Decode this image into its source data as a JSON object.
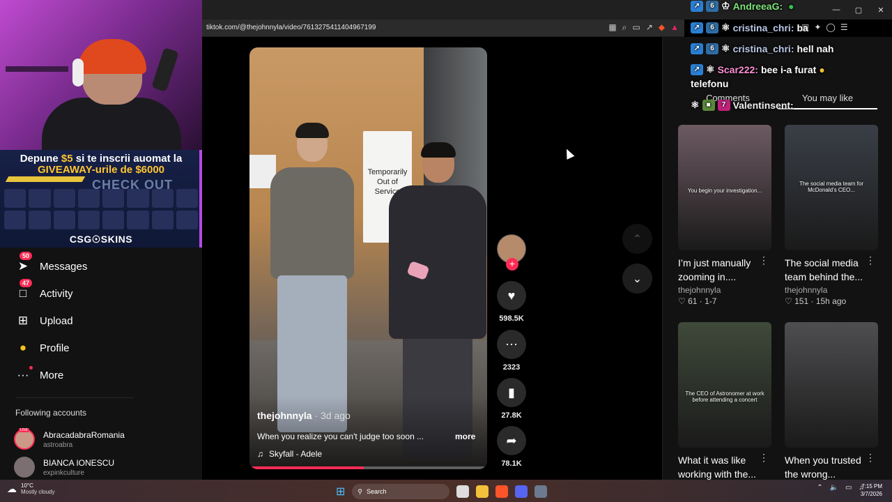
{
  "webcam_overlay": {
    "promo_line1_prefix": "Depune",
    "promo_amount1": "$5",
    "promo_line1_suffix": "si te inscrii auomat la",
    "promo_line2_prefix": "GIVEAWAY-urile de",
    "promo_amount2": "$6000",
    "promo_check": "CHECK OUT",
    "brand": "CSG☉SKINS"
  },
  "browser": {
    "url": "tiktok.com/@thejohnnyla/video/7613275411404967199",
    "window_controls": [
      "—",
      "▢",
      "✕"
    ]
  },
  "sidebar": {
    "items": [
      {
        "label": "Messages",
        "icon": "paper-plane-icon",
        "badge": "50"
      },
      {
        "label": "Activity",
        "icon": "inbox-icon",
        "badge": "47"
      },
      {
        "label": "Upload",
        "icon": "plus-square-icon"
      },
      {
        "label": "Profile",
        "icon": "avatar-emoji-icon"
      },
      {
        "label": "More",
        "icon": "ellipsis-icon"
      }
    ],
    "following_title": "Following accounts",
    "following": [
      {
        "name": "AbracadabraRomania",
        "handle": "astroabra",
        "live": "LIVE"
      },
      {
        "name": "BIANCA IONESCU",
        "handle": "expinkculture"
      }
    ]
  },
  "video": {
    "author": "thejohnnyla",
    "posted": " · 3d ago",
    "caption": "When you realize you can't judge too soon ...",
    "more_label": "more",
    "music": "Skyfall - Adele",
    "sign_text": "Temporarily Out of Service",
    "progress_fraction": 0.48
  },
  "actions": {
    "likes": "598.5K",
    "comments": "2323",
    "saves": "27.8K",
    "shares": "78.1K"
  },
  "chat": [
    {
      "user": "AndreeaG:",
      "message": "",
      "color": "#7ee37a"
    },
    {
      "user": "cristina_chri:",
      "message": "ba",
      "color": "#b9c6e4"
    },
    {
      "user": "cristina_chri:",
      "message": "hell nah",
      "color": "#b9c6e4"
    },
    {
      "user": "Scar222:",
      "message": "bee i-a furat",
      "message2": "telefonu",
      "color": "#ff8fd4"
    },
    {
      "user": "Valentinsent:",
      "message": "",
      "color": "#f0f0f0"
    }
  ],
  "right_panel": {
    "tabs": [
      "Comments",
      "You may like"
    ],
    "cards": [
      {
        "title": "I’m just manually zooming in....",
        "user": "thejohnnyla",
        "likes": "61",
        "date": "1-7",
        "overlay": "You begin your investigation...",
        "thumb_color": "#6d5a63"
      },
      {
        "title": "The social media team behind the...",
        "user": "thejohnnyla",
        "likes": "151",
        "date": "15h ago",
        "overlay": "The social media team for McDonald’s CEO...",
        "thumb_color": "#3a3f47"
      },
      {
        "title": "What it was like working with the...",
        "user": "",
        "likes": "",
        "date": "",
        "overlay": "The CEO of Astronomer at work before attending a concert",
        "thumb_color": "#3f4a3a"
      },
      {
        "title": "When you trusted the wrong...",
        "user": "",
        "likes": "",
        "date": "",
        "overlay": "",
        "thumb_color": "#4e4d50"
      }
    ]
  },
  "taskbar": {
    "temp": "10°C",
    "condition": "Mostly cloudy",
    "search": "Search",
    "time": "7:15 PM",
    "date": "3/7/2026"
  }
}
